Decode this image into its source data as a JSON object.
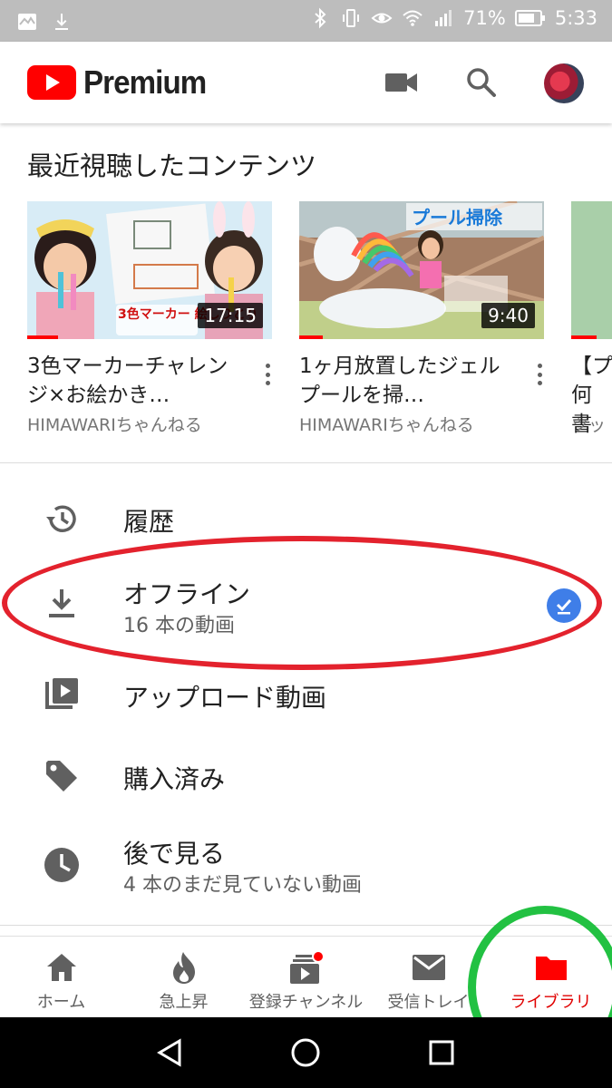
{
  "status_bar": {
    "battery_percent": "71%",
    "time": "5:33"
  },
  "app_bar": {
    "logo_text": "Premium",
    "brand_color": "#FF0000"
  },
  "recent": {
    "title": "最近視聴したコンテンツ",
    "videos": [
      {
        "title": "3色マーカーチャレンジ×お絵かき…",
        "channel": "HIMAWARIちゃんねる",
        "duration": "17:15",
        "thumb_text": "3色マーカー 絵しりとり"
      },
      {
        "title": "1ヶ月放置したジェルプールを掃…",
        "channel": "HIMAWARIちゃんねる",
        "duration": "9:40",
        "thumb_text": "プール掃除"
      },
      {
        "title": "【プ 何書",
        "channel": "ツッ",
        "duration": "",
        "thumb_text": ""
      }
    ]
  },
  "library": {
    "items": [
      {
        "label": "履歴",
        "icon": "history-icon"
      },
      {
        "label": "オフライン",
        "subtitle": "16 本の動画",
        "icon": "download-icon"
      },
      {
        "label": "アップロード動画",
        "icon": "uploads-icon"
      },
      {
        "label": "購入済み",
        "icon": "tag-icon"
      },
      {
        "label": "後で見る",
        "subtitle": "4 本のまだ見ていない動画",
        "icon": "clock-icon"
      }
    ]
  },
  "bottom_nav": {
    "items": [
      {
        "label": "ホーム",
        "icon": "home-icon"
      },
      {
        "label": "急上昇",
        "icon": "flame-icon"
      },
      {
        "label": "登録チャンネル",
        "icon": "subscriptions-icon"
      },
      {
        "label": "受信トレイ",
        "icon": "mail-icon"
      },
      {
        "label": "ライブラリ",
        "icon": "library-folder-icon",
        "active": true
      }
    ]
  },
  "colors": {
    "accent_red": "#FF0000",
    "annotation_red": "#E3222D",
    "annotation_green": "#22C142",
    "badge_blue": "#3F7EE8"
  }
}
